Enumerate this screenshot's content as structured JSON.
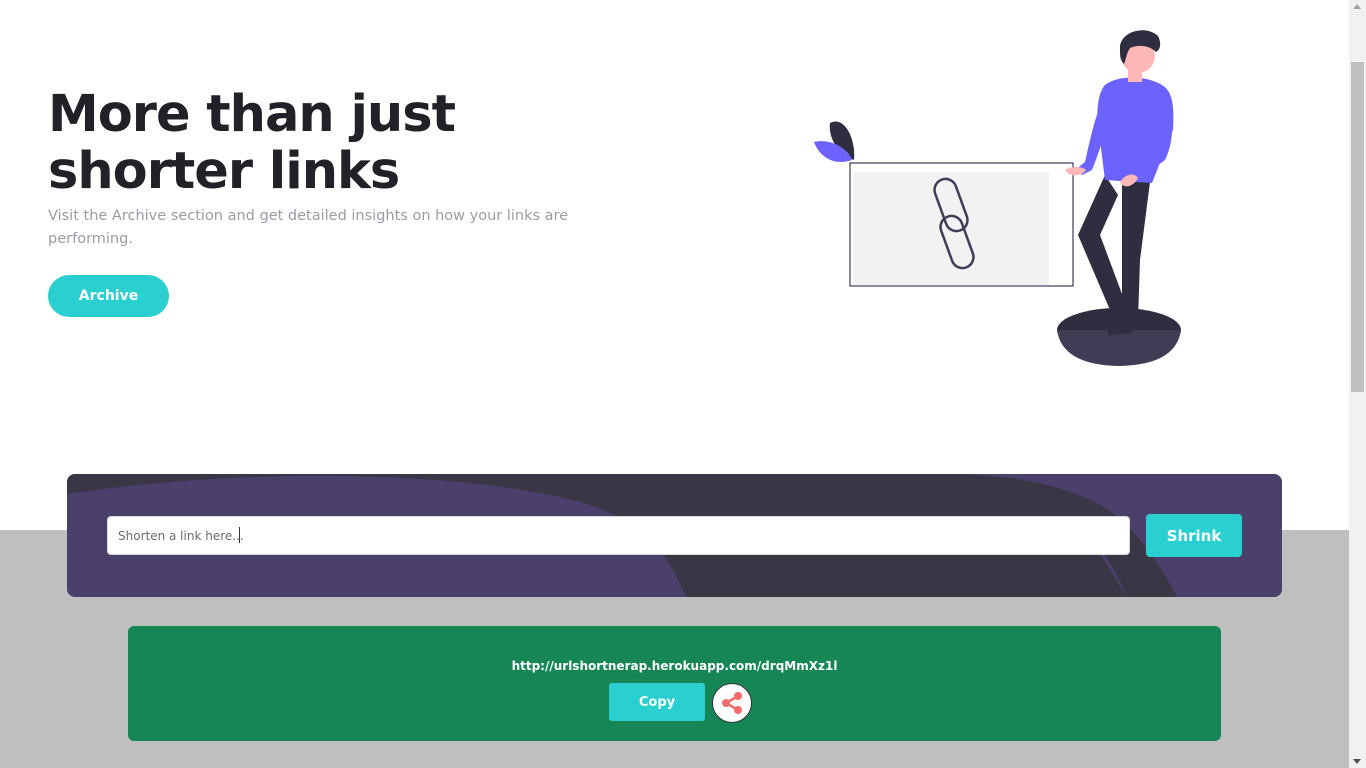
{
  "hero": {
    "title": "More than just shorter links",
    "subtitle": "Visit the Archive section and get detailed insights on how your links are performing.",
    "archive_label": "Archive"
  },
  "shortener": {
    "placeholder": "Shorten a link here...",
    "value": "",
    "shrink_label": "Shrink"
  },
  "result": {
    "short_url": "http://urlshortnerap.herokuapp.com/drqMmXz1l",
    "copy_label": "Copy",
    "share_icon": "share-icon"
  },
  "colors": {
    "accent": "#2acfcf",
    "shorten_bg": "#4b3f6b",
    "result_bg": "#178656",
    "title": "#232127",
    "subtitle": "#9e9aa7",
    "figure_shirt": "#6c63ff"
  }
}
